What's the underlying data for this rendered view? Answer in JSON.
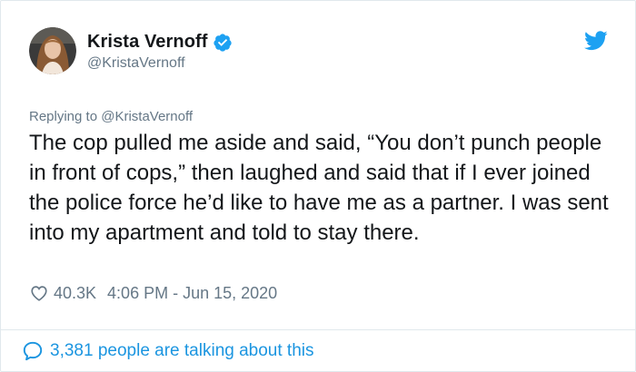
{
  "tweet": {
    "author": {
      "name": "Krista Vernoff",
      "handle": "@KristaVernoff",
      "verified": true
    },
    "replying_prefix": "Replying to",
    "replying_to": "@KristaVernoff",
    "text": "The cop pulled me aside and said, “You don’t punch people in front of cops,” then laughed and said that if I ever joined the police force he’d like to have me as a partner. I was sent into my apartment and told to stay there.",
    "likes": "40.3K",
    "timestamp": "4:06 PM - Jun 15, 2020",
    "talking": "3,381 people are talking about this"
  },
  "icons": {
    "verified": "verified-badge-icon",
    "platform": "twitter-bird-icon",
    "like": "heart-icon",
    "reply": "speech-bubble-icon"
  },
  "colors": {
    "accent": "#1da1f2",
    "link": "#1b95e0",
    "muted": "#657786",
    "text": "#14171a"
  }
}
